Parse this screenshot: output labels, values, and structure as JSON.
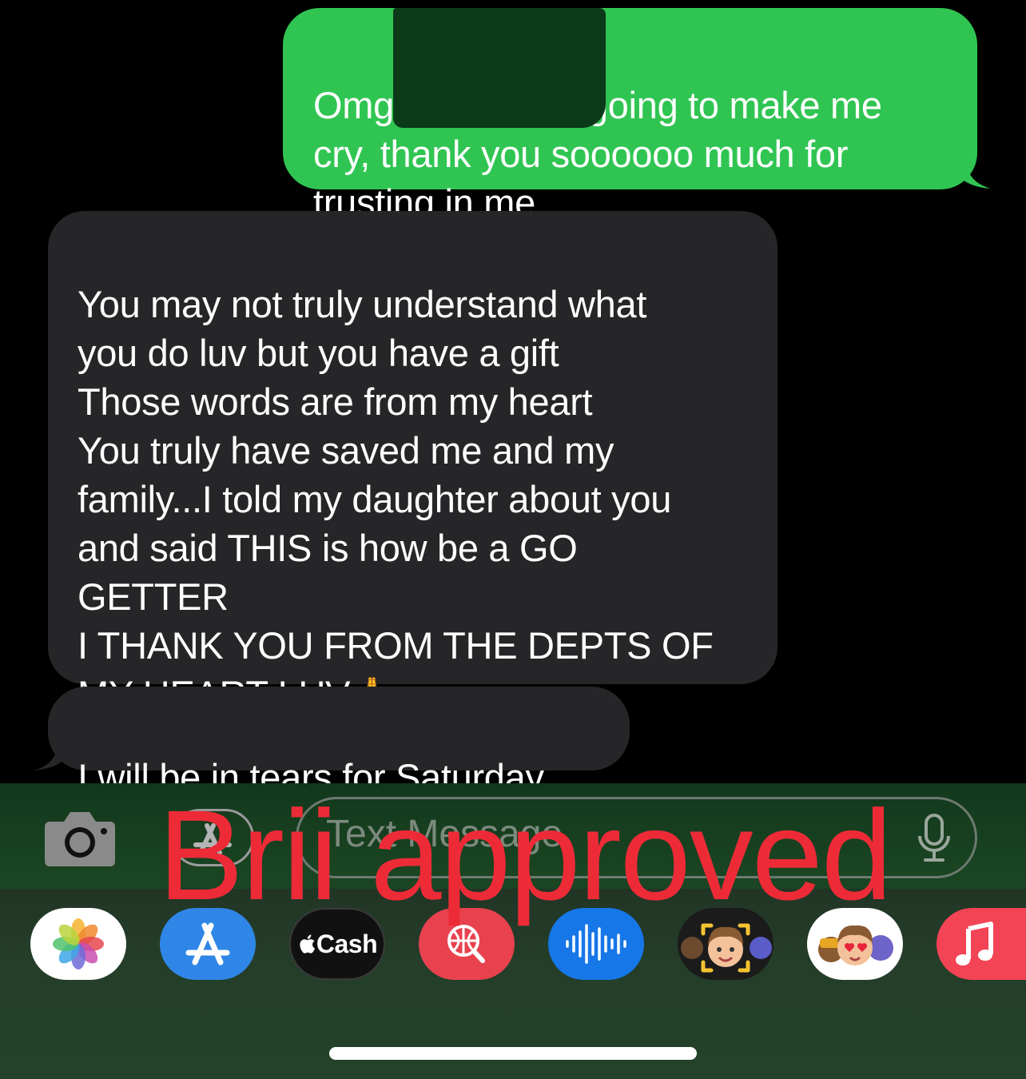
{
  "conversation": {
    "sent": [
      {
        "text": "Omg Nicole you going to make me\ncry, thank you soooooo much for\ntrusting in me"
      }
    ],
    "received": [
      {
        "text": "You may not truly understand what\nyou do luv but you have a gift\nThose words are from my heart\nYou truly have saved me and my\nfamily...I told my daughter about you\nand said THIS is how be a GO\nGETTER\nI THANK YOU FROM THE DEPTS OF\nMY HEART LUV",
        "emoji": "🙏"
      },
      {
        "text": "I will be in tears for Saturday"
      }
    ]
  },
  "input_bar": {
    "placeholder": "Text Message",
    "icons": [
      "camera-icon",
      "app-store-icon",
      "microphone-icon"
    ]
  },
  "watermark": "Brii approved",
  "app_tray": [
    {
      "name": "photos-app",
      "icon": "photos-icon"
    },
    {
      "name": "app-store-app",
      "icon": "app-store-icon"
    },
    {
      "name": "cash-app",
      "label": "Cash",
      "icon": "apple-logo-icon"
    },
    {
      "name": "image-search-app",
      "icon": "globe-search-icon"
    },
    {
      "name": "audio-message-app",
      "icon": "waveform-icon"
    },
    {
      "name": "memoji-app",
      "icon": "memoji-icon"
    },
    {
      "name": "memoji-stickers-app",
      "icon": "memoji-stickers-icon"
    },
    {
      "name": "music-app",
      "icon": "music-note-icon"
    }
  ],
  "colors": {
    "sent_bubble": "#30c552",
    "received_bubble": "#262628",
    "watermark": "#ed2b37",
    "background": "#000000"
  }
}
